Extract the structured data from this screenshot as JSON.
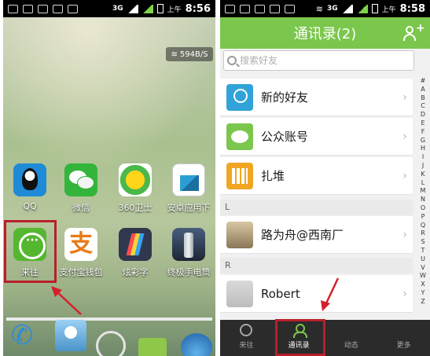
{
  "left_phone": {
    "status": {
      "network": "3G",
      "ampm": "上午",
      "time": "8:56"
    },
    "speed": "594B/S",
    "apps_row1": [
      {
        "label": "QQ",
        "icon": "qq-icon"
      },
      {
        "label": "微信",
        "icon": "wechat-icon"
      },
      {
        "label": "360卫士",
        "icon": "security-360-icon"
      },
      {
        "label": "安卓应用下",
        "icon": "app-store-icon"
      }
    ],
    "apps_row2": [
      {
        "label": "来往",
        "icon": "laiwang-icon"
      },
      {
        "label": "支付宝钱包",
        "icon": "alipay-icon"
      },
      {
        "label": "炫彩字",
        "icon": "colorful-text-icon"
      },
      {
        "label": "终极手电筒",
        "icon": "flashlight-icon"
      }
    ],
    "highlight_color": "#b7202b"
  },
  "right_phone": {
    "status": {
      "network": "3G",
      "ampm": "上午",
      "time": "8:58"
    },
    "title": "通讯录(2)",
    "search": {
      "placeholder": "搜索好友"
    },
    "fixed_items": [
      {
        "name": "新的好友",
        "icon": "new-friend-icon"
      },
      {
        "name": "公众账号",
        "icon": "public-account-icon"
      },
      {
        "name": "扎堆",
        "icon": "zhadui-icon"
      }
    ],
    "sections": [
      {
        "letter": "L",
        "contacts": [
          {
            "name": "路为舟@西南厂"
          }
        ]
      },
      {
        "letter": "R",
        "contacts": [
          {
            "name": "Robert"
          }
        ]
      }
    ],
    "alphabet": [
      "#",
      "A",
      "B",
      "C",
      "D",
      "E",
      "F",
      "G",
      "H",
      "I",
      "J",
      "K",
      "L",
      "M",
      "N",
      "O",
      "P",
      "Q",
      "R",
      "S",
      "T",
      "U",
      "V",
      "W",
      "X",
      "Y",
      "Z"
    ],
    "tabs": [
      {
        "label": "来往",
        "active": false
      },
      {
        "label": "通讯录",
        "active": true
      },
      {
        "label": "动态",
        "active": false
      },
      {
        "label": "更多",
        "active": false
      }
    ],
    "accent_color": "#7bc74d"
  }
}
